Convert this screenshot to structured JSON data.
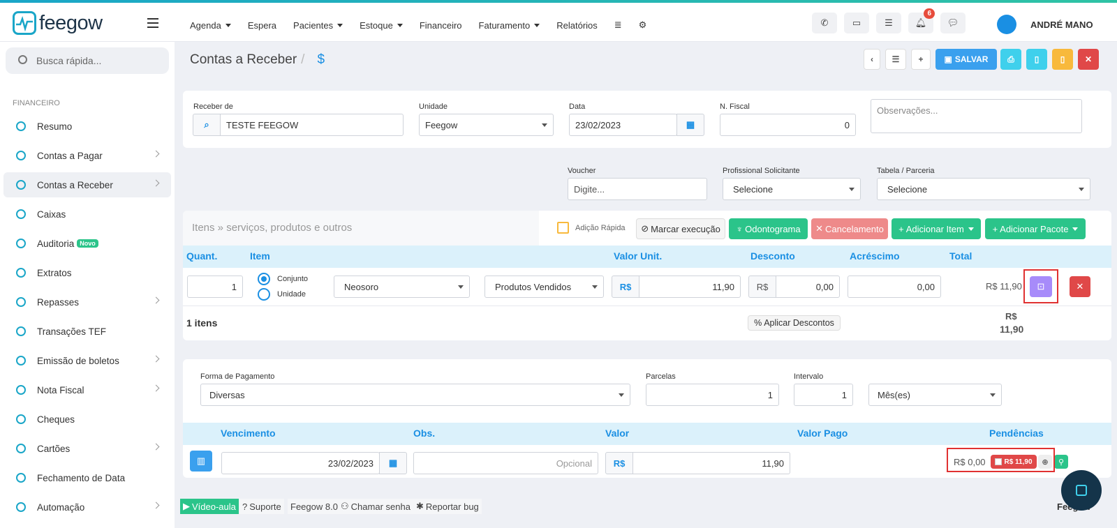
{
  "app": {
    "logo_text": "feegow",
    "user_name": "ANDRÉ MANO",
    "notif_count": "6"
  },
  "nav": {
    "items": [
      "Agenda",
      "Espera",
      "Pacientes",
      "Estoque",
      "Financeiro",
      "Faturamento",
      "Relatórios"
    ]
  },
  "sidebar": {
    "search_placeholder": "Busca rápida...",
    "section": "FINANCEIRO",
    "items": [
      {
        "label": "Resumo"
      },
      {
        "label": "Contas a Pagar"
      },
      {
        "label": "Contas a Receber"
      },
      {
        "label": "Caixas"
      },
      {
        "label": "Auditoria",
        "badge": "Novo"
      },
      {
        "label": "Extratos"
      },
      {
        "label": "Repasses"
      },
      {
        "label": "Transações TEF"
      },
      {
        "label": "Emissão de boletos"
      },
      {
        "label": "Nota Fiscal"
      },
      {
        "label": "Cheques"
      },
      {
        "label": "Cartões"
      },
      {
        "label": "Fechamento de Data"
      },
      {
        "label": "Automação"
      }
    ]
  },
  "page": {
    "title": "Contas a Receber",
    "crumb": "$",
    "save_label": "SALVAR"
  },
  "form": {
    "receber_label": "Receber de",
    "receber_value": "TESTE FEEGOW",
    "unidade_label": "Unidade",
    "unidade_value": "Feegow",
    "data_label": "Data",
    "data_value": "23/02/2023",
    "nfiscal_label": "N. Fiscal",
    "nfiscal_value": "0",
    "obs_placeholder": "Observações...",
    "voucher_label": "Voucher",
    "voucher_placeholder": "Digite...",
    "prof_label": "Profissional Solicitante",
    "prof_value": "Selecione",
    "tabela_label": "Tabela / Parceria",
    "tabela_value": "Selecione"
  },
  "items": {
    "title": "Itens » serviços, produtos e outros",
    "quick_add": "Adição Rápida",
    "mark_exec": "Marcar execução",
    "odonto": "Odontograma",
    "cancel": "Cancelamento",
    "add_item": "Adicionar Item",
    "add_pack": "Adicionar Pacote",
    "headers": [
      "Quant.",
      "Item",
      "Valor Unit.",
      "Desconto",
      "Acréscimo",
      "Total"
    ],
    "row": {
      "qty": "1",
      "conjunto": "Conjunto",
      "unidade": "Unidade",
      "item": "Neosoro",
      "category": "Produtos Vendidos",
      "currency": "R$",
      "unit_value": "11,90",
      "discount": "0,00",
      "addition": "0,00",
      "total": "R$ 11,90"
    },
    "count": "1 itens",
    "apply_discounts": "Aplicar Descontos",
    "sum_currency": "R$",
    "sum_value": "11,90"
  },
  "payment": {
    "forma_label": "Forma de Pagamento",
    "forma_value": "Diversas",
    "parcelas_label": "Parcelas",
    "parcelas_value": "1",
    "intervalo_label": "Intervalo",
    "intervalo_value": "1",
    "periodo_value": "Mês(es)",
    "headers": [
      "Vencimento",
      "Obs.",
      "Valor",
      "Valor Pago",
      "Pendências"
    ],
    "row": {
      "due": "23/02/2023",
      "obs_placeholder": "Opcional",
      "currency": "R$",
      "value": "11,90",
      "paid": "R$ 0,00",
      "pending": "R$ 11,90"
    }
  },
  "footer": {
    "video": "Vídeo-aula",
    "support": "Suporte",
    "version": "Feegow 8.0",
    "call": "Chamar senha",
    "bug": "Reportar bug",
    "brand": "Feegow"
  }
}
